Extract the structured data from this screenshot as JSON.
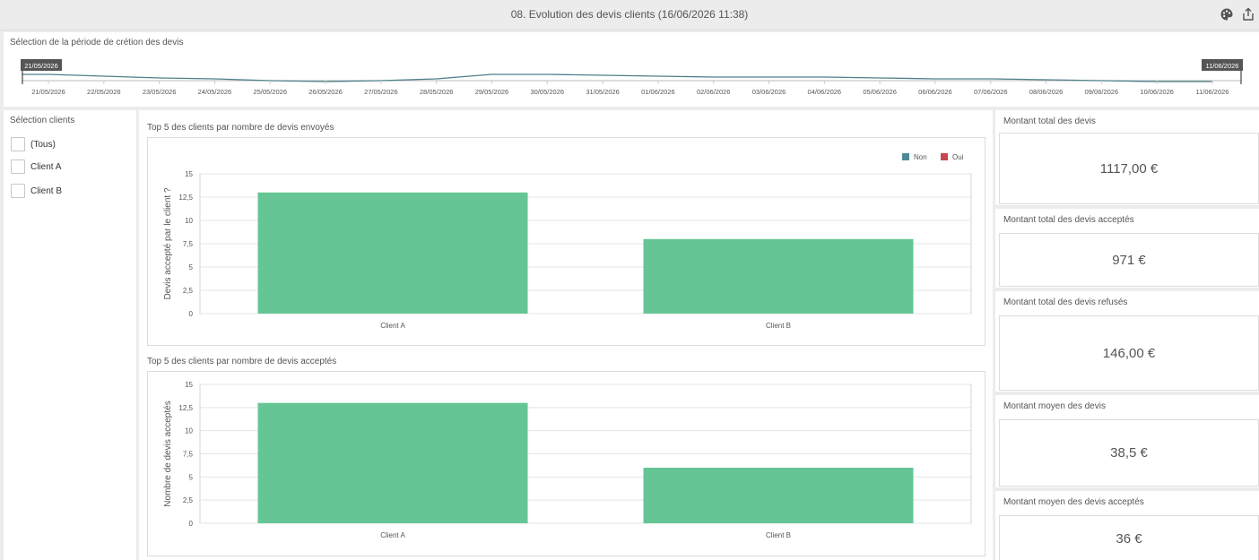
{
  "window": {
    "title": "08. Evolution des devis clients (16/06/2026 11:38)",
    "icons": [
      "palette-icon",
      "export-icon"
    ]
  },
  "timeline": {
    "title": "Sélection de la période de crétion des devis",
    "start_label": "21/05/2026",
    "end_label": "11/06/2026",
    "dates": [
      "21/05/2026",
      "22/05/2026",
      "23/05/2026",
      "24/05/2026",
      "25/05/2026",
      "26/05/2026",
      "27/05/2026",
      "28/05/2026",
      "29/05/2026",
      "30/05/2026",
      "31/05/2026",
      "01/06/2026",
      "02/06/2026",
      "03/06/2026",
      "04/06/2026",
      "05/06/2026",
      "06/06/2026",
      "07/06/2026",
      "08/06/2026",
      "09/06/2026",
      "10/06/2026",
      "11/06/2026"
    ],
    "line_color": "#4f7f8a"
  },
  "clients_filter": {
    "title": "Sélection clients",
    "options": [
      "(Tous)",
      "Client A",
      "Client B"
    ]
  },
  "legend": [
    {
      "label": "Non",
      "color": "#4f8a96"
    },
    {
      "label": "Oui",
      "color": "#c8474f"
    }
  ],
  "chart_data": [
    {
      "type": "bar",
      "title": "Top 5 des clients par nombre de devis envoyés",
      "categories": [
        "Client A",
        "Client B"
      ],
      "series": [
        {
          "values": [
            13,
            8
          ]
        }
      ],
      "ylabel": "Devis accepté par le client ?",
      "yticks": [
        "0",
        "2,5",
        "5",
        "7,5",
        "10",
        "12,5",
        "15"
      ],
      "ylim": [
        0,
        15
      ],
      "bar_color": "#66c594",
      "legend": "top-right",
      "grid": true
    },
    {
      "type": "bar",
      "title": "Top 5 des clients par nombre de devis acceptés",
      "categories": [
        "Client A",
        "Client B"
      ],
      "series": [
        {
          "values": [
            13,
            6
          ]
        }
      ],
      "ylabel": "Nombre de devis acceptés",
      "yticks": [
        "0",
        "2,5",
        "5",
        "7,5",
        "10",
        "12,5",
        "15"
      ],
      "ylim": [
        0,
        15
      ],
      "bar_color": "#66c594",
      "grid": true
    }
  ],
  "kpis": [
    {
      "title": "Montant total des devis",
      "value": "1117,00 €"
    },
    {
      "title": "Montant total des devis acceptés",
      "value": "971 €"
    },
    {
      "title": "Montant total des devis refusés",
      "value": "146,00 €"
    },
    {
      "title": "Montant moyen des devis",
      "value": "38,5 €"
    },
    {
      "title": "Montant moyen des devis acceptés",
      "value": "36 €"
    }
  ]
}
